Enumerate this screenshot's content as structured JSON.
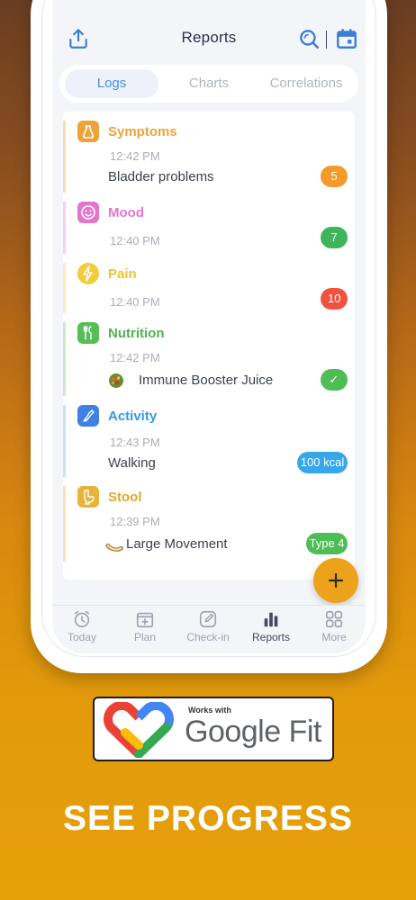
{
  "header": {
    "title": "Reports",
    "share_icon": "share-icon",
    "search_icon": "search-icon",
    "calendar_icon": "calendar-icon"
  },
  "tabs": [
    {
      "label": "Logs",
      "active": true
    },
    {
      "label": "Charts",
      "active": false
    },
    {
      "label": "Correlations",
      "active": false
    }
  ],
  "entries": [
    {
      "category": "Symptoms",
      "color": "#efa23a",
      "time": "12:42 PM",
      "description": "Bladder problems",
      "badge": "5",
      "badge_color": "#f39a2a",
      "icon": "bladder-icon"
    },
    {
      "category": "Mood",
      "color": "#e177cc",
      "time": "12:40 PM",
      "description": "",
      "badge": "7",
      "badge_color": "#3fb55a",
      "icon": "smiley-icon"
    },
    {
      "category": "Pain",
      "color": "#f2cc3d",
      "time": "12:40 PM",
      "description": "",
      "badge": "10",
      "badge_color": "#ef5340",
      "icon": "lightning-icon"
    },
    {
      "category": "Nutrition",
      "color": "#57bd55",
      "time": "12:42 PM",
      "description": "Immune Booster Juice",
      "badge": "✓",
      "badge_color": "#4fbd56",
      "icon": "utensils-icon"
    },
    {
      "category": "Activity",
      "color": "#3aa5e8",
      "time": "12:43 PM",
      "description": "Walking",
      "badge": "100 kcal",
      "badge_color": "#35a7ea",
      "icon": "shoe-icon"
    },
    {
      "category": "Stool",
      "color": "#e8b33a",
      "time": "12:39 PM",
      "description": "Large Movement",
      "badge": "Type 4",
      "badge_color": "#4fbd56",
      "icon": "toilet-icon"
    }
  ],
  "fab": {
    "label": "+"
  },
  "bottom_nav": [
    {
      "label": "Today",
      "icon": "alarm-clock-icon",
      "active": false
    },
    {
      "label": "Plan",
      "icon": "plan-add-icon",
      "active": false
    },
    {
      "label": "Check-in",
      "icon": "edit-icon",
      "active": false
    },
    {
      "label": "Reports",
      "icon": "bar-chart-icon",
      "active": true
    },
    {
      "label": "More",
      "icon": "grid-icon",
      "active": false
    }
  ],
  "google_fit": {
    "works_with": "Works with",
    "brand": "Google Fit"
  },
  "headline": "SEE PROGRESS",
  "colors": {
    "accent_blue": "#4a8fe7",
    "fab_orange": "#eda21c"
  }
}
